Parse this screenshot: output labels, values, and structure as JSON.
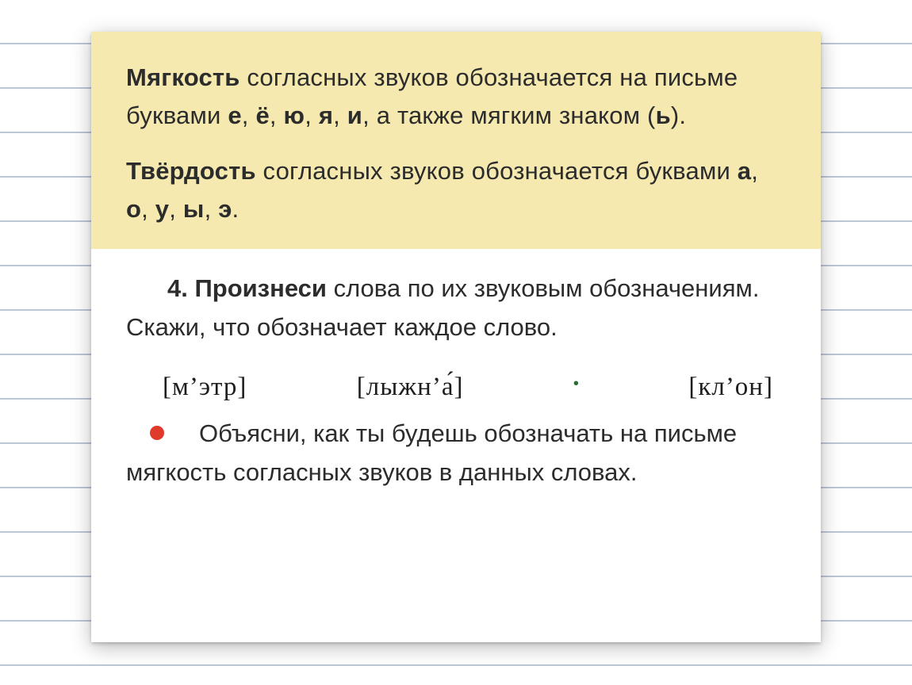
{
  "rule1": {
    "lead_bold": "Мягкость",
    "t1": " согласных звуков обозначается на письме буквами ",
    "l1": "е",
    "sep": ", ",
    "l2": "ё",
    "l3": "ю",
    "l4": "я",
    "l5": "и",
    "t2": ", а так­же мягким знаком (",
    "l6": "ь",
    "t3": ")."
  },
  "rule2": {
    "lead_bold": "Твёрдость",
    "t1": " согласных звуков обозначается буквами ",
    "l1": "а",
    "sep": ", ",
    "l2": "о",
    "l3": "у",
    "l4": "ы",
    "l5": "э",
    "t2": "."
  },
  "exercise": {
    "num": "4.",
    "verb": " Произнеси",
    "rest": " слова по их звуковым обознач­ениям. Скажи, что обозначает каждое слово."
  },
  "phon": {
    "w1": "[м’этр]",
    "w2_pre": "[лыжн’",
    "w2_vowel": "а",
    "w2_post": "]",
    "w3": "[кл’он]"
  },
  "followup": {
    "text": "Объясни, как ты будешь обозначать на письме мягкость согласных звуков в данных словах."
  }
}
